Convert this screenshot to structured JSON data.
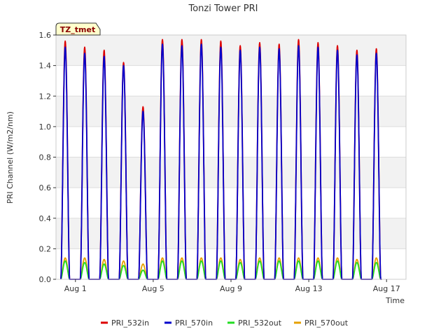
{
  "chart_data": {
    "type": "line",
    "title": "Tonzi Tower PRI",
    "xlabel": "Time",
    "ylabel": "PRI Channel (W/m2/nm)",
    "badge": "TZ_tmet",
    "xlim": [
      0.0,
      18.0
    ],
    "ylim": [
      0.0,
      1.6
    ],
    "x_ticks": [
      {
        "value": 1,
        "label": "Aug 1"
      },
      {
        "value": 5,
        "label": "Aug 5"
      },
      {
        "value": 9,
        "label": "Aug 9"
      },
      {
        "value": 13,
        "label": "Aug 13"
      },
      {
        "value": 17,
        "label": "Aug 17"
      }
    ],
    "y_ticks": [
      {
        "value": 0.0,
        "label": "0.0"
      },
      {
        "value": 0.2,
        "label": "0.2"
      },
      {
        "value": 0.4,
        "label": "0.4"
      },
      {
        "value": 0.6,
        "label": "0.6"
      },
      {
        "value": 0.8,
        "label": "0.8"
      },
      {
        "value": 1.0,
        "label": "1.0"
      },
      {
        "value": 1.2,
        "label": "1.2"
      },
      {
        "value": 1.4,
        "label": "1.4"
      },
      {
        "value": 1.6,
        "label": "1.6"
      }
    ],
    "grid": true,
    "legend_position": "bottom",
    "days": [
      1,
      2,
      3,
      4,
      5,
      6,
      7,
      8,
      9,
      10,
      11,
      12,
      13,
      14,
      15,
      16,
      17
    ],
    "series": [
      {
        "name": "PRI_532in",
        "color": "#dd0000",
        "daily_peaks": [
          1.56,
          1.52,
          1.5,
          1.42,
          1.13,
          1.57,
          1.57,
          1.57,
          1.56,
          1.53,
          1.55,
          1.54,
          1.57,
          1.55,
          1.53,
          1.5,
          1.51
        ]
      },
      {
        "name": "PRI_570in",
        "color": "#0000cc",
        "daily_peaks": [
          1.52,
          1.48,
          1.46,
          1.4,
          1.1,
          1.54,
          1.53,
          1.54,
          1.52,
          1.5,
          1.52,
          1.51,
          1.53,
          1.52,
          1.5,
          1.47,
          1.48
        ]
      },
      {
        "name": "PRI_532out",
        "color": "#22dd22",
        "daily_peaks": [
          0.12,
          0.11,
          0.1,
          0.09,
          0.06,
          0.12,
          0.12,
          0.12,
          0.12,
          0.11,
          0.12,
          0.12,
          0.12,
          0.12,
          0.12,
          0.11,
          0.11
        ]
      },
      {
        "name": "PRI_570out",
        "color": "#e6a000",
        "daily_peaks": [
          0.14,
          0.14,
          0.13,
          0.12,
          0.1,
          0.14,
          0.14,
          0.14,
          0.14,
          0.13,
          0.14,
          0.14,
          0.14,
          0.14,
          0.14,
          0.13,
          0.14
        ]
      }
    ]
  }
}
